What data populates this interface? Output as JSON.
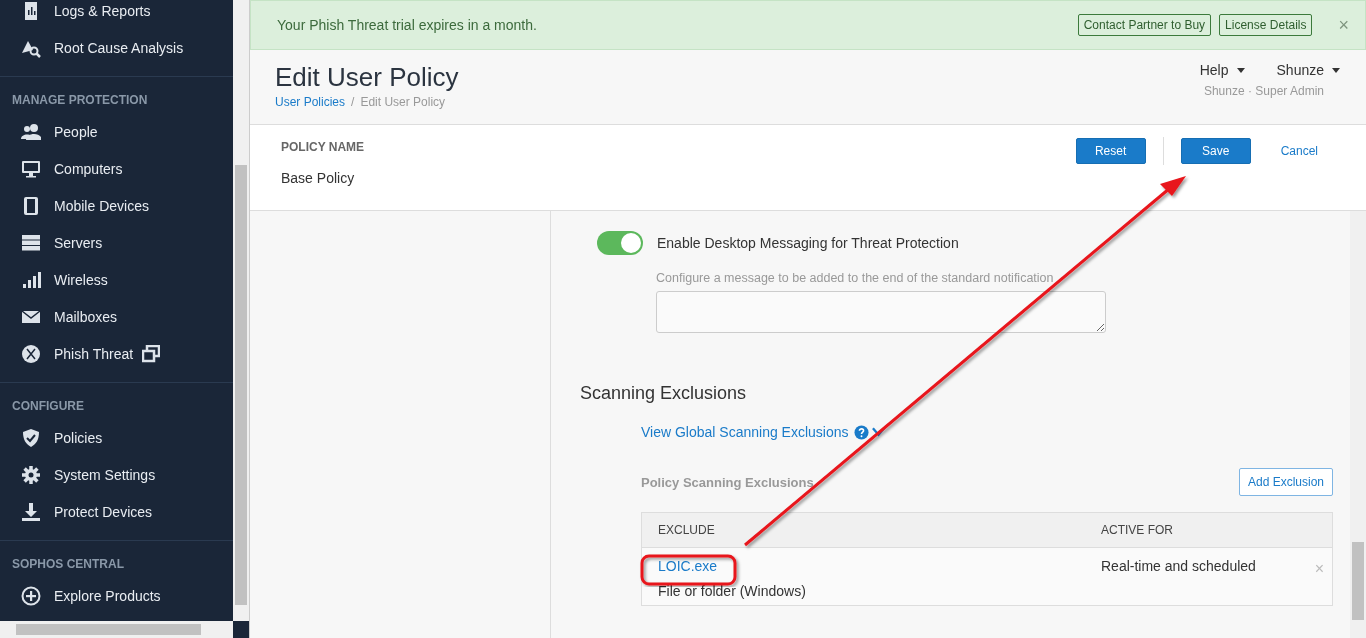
{
  "sidebar": {
    "sections": [
      {
        "items": [
          {
            "label": "Logs & Reports",
            "external": false
          },
          {
            "label": "Root Cause Analysis",
            "external": false
          }
        ]
      },
      {
        "title": "MANAGE PROTECTION",
        "items": [
          {
            "label": "People",
            "external": false
          },
          {
            "label": "Computers",
            "external": false
          },
          {
            "label": "Mobile Devices",
            "external": false
          },
          {
            "label": "Servers",
            "external": false
          },
          {
            "label": "Wireless",
            "external": false
          },
          {
            "label": "Mailboxes",
            "external": false
          },
          {
            "label": "Phish Threat",
            "external": true
          }
        ]
      },
      {
        "title": "CONFIGURE",
        "items": [
          {
            "label": "Policies",
            "external": false
          },
          {
            "label": "System Settings",
            "external": false
          },
          {
            "label": "Protect Devices",
            "external": false
          }
        ]
      },
      {
        "title": "SOPHOS CENTRAL",
        "items": [
          {
            "label": "Explore Products",
            "external": false
          }
        ]
      }
    ]
  },
  "banner": {
    "message": "Your Phish Threat trial expires in a month.",
    "buttons": [
      "Contact Partner to Buy",
      "License Details"
    ],
    "close": "×"
  },
  "header": {
    "title": "Edit User Policy",
    "breadcrumbs": [
      "User Policies",
      "Edit User Policy"
    ],
    "breadcrumb_separator": "/",
    "help": "Help",
    "user": "Shunze",
    "role": "Shunze · Super Admin"
  },
  "policy": {
    "label": "POLICY NAME",
    "name": "Base Policy",
    "buttons": {
      "reset": "Reset",
      "save": "Save",
      "cancel": "Cancel"
    }
  },
  "messaging": {
    "toggle_label": "Enable Desktop Messaging for Threat Protection",
    "on": true,
    "message_label": "Configure a message to be added to the end of the standard notification"
  },
  "exclusions": {
    "title": "Scanning Exclusions",
    "global_link": "View Global Scanning Exclusions",
    "policy_title": "Policy Scanning Exclusions",
    "add_button": "Add Exclusion",
    "columns": [
      "EXCLUDE",
      "ACTIVE FOR"
    ],
    "rows": [
      {
        "name": "LOIC.exe",
        "type": "File or folder (Windows)",
        "active_for": "Real-time and scheduled",
        "remove": "×"
      }
    ]
  }
}
